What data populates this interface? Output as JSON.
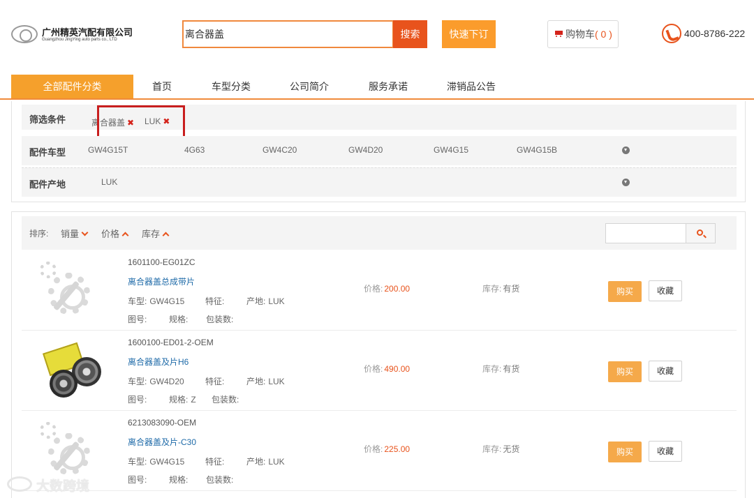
{
  "header": {
    "company_name_cn": "广州精英汽配有限公司",
    "company_name_en": "Guangzhou JingYing auto parts co., LTD",
    "search_value": "离合器盖",
    "search_button": "搜索",
    "quick_order_button": "快速下订",
    "cart_label": "购物车",
    "cart_count": "( 0 )",
    "phone": "400-8786-222"
  },
  "nav": {
    "all_categories": "全部配件分类",
    "items": [
      "首页",
      "车型分类",
      "公司简介",
      "服务承诺",
      "滞销品公告"
    ]
  },
  "filters": {
    "selected_label": "筛选条件",
    "selected_tags": [
      "离合器盖",
      "LUK"
    ],
    "model_label": "配件车型",
    "models": [
      "GW4G15T",
      "4G63",
      "GW4C20",
      "GW4D20",
      "GW4G15",
      "GW4G15B"
    ],
    "origin_label": "配件产地",
    "origins": [
      "LUK"
    ]
  },
  "sort": {
    "label": "排序:",
    "items": [
      {
        "label": "销量",
        "direction": "down"
      },
      {
        "label": "价格",
        "direction": "up"
      },
      {
        "label": "库存",
        "direction": "up"
      }
    ]
  },
  "labels": {
    "model": "车型:",
    "feature": "特征:",
    "origin": "产地:",
    "drawing_no": "图号:",
    "spec": "规格:",
    "pack_qty": "包装数:",
    "price": "价格:",
    "stock": "库存:",
    "buy": "购买",
    "favorite": "收藏"
  },
  "products": [
    {
      "part_no": "1601100-EG01ZC",
      "name": "离合器盖总成带片",
      "model": "GW4G15",
      "feature": "",
      "origin": "LUK",
      "drawing_no": "",
      "spec": "",
      "pack_qty": "",
      "price": "200.00",
      "stock": "有货",
      "thumb": "gear-placeholder-icon"
    },
    {
      "part_no": "1600100-ED01-2-OEM",
      "name": "离合器盖及片H6",
      "model": "GW4D20",
      "feature": "",
      "origin": "LUK",
      "drawing_no": "",
      "spec": "Z",
      "pack_qty": "",
      "price": "490.00",
      "stock": "有货",
      "thumb": "clutch-kit-photo"
    },
    {
      "part_no": "6213083090-OEM",
      "name": "离合器盖及片-C30",
      "model": "GW4G15",
      "feature": "",
      "origin": "LUK",
      "drawing_no": "",
      "spec": "",
      "pack_qty": "",
      "price": "225.00",
      "stock": "无货",
      "thumb": "gear-placeholder-icon"
    }
  ],
  "watermark": "大数跨境",
  "colors": {
    "accent_orange": "#fb9c2c",
    "search_orange": "#e8531c",
    "highlight_red": "#c81e1e",
    "link_blue": "#1e6aa8"
  }
}
